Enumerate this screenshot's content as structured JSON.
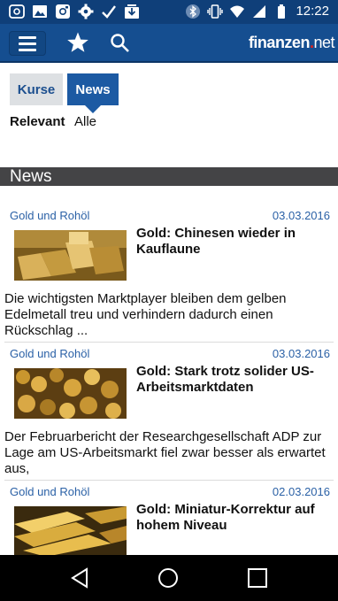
{
  "status_bar": {
    "time": "12:22",
    "left_icons": [
      "app-notification-icon",
      "gallery-icon",
      "instagram-icon",
      "settings-icon",
      "check-icon",
      "download-icon"
    ],
    "right_icons": [
      "bluetooth-icon",
      "vibrate-icon",
      "wifi-icon",
      "signal-icon",
      "battery-icon"
    ]
  },
  "app_bar": {
    "logo_main": "finanzen",
    "logo_dot": ".",
    "logo_tld": "net",
    "icons": [
      "menu-icon",
      "star-icon",
      "search-icon"
    ]
  },
  "tabs": [
    {
      "label": "Kurse",
      "active": false
    },
    {
      "label": "News",
      "active": true
    }
  ],
  "filters": {
    "relevant": "Relevant",
    "alle": "Alle"
  },
  "section": {
    "title": "News"
  },
  "news": [
    {
      "category": "Gold und Rohöl",
      "date": "03.03.2016",
      "headline": "Gold: Chinesen wieder in Kauflaune",
      "teaser": "Die wichtigsten Marktplayer bleiben dem gelben Edelmetall treu und verhindern dadurch einen Rückschlag ..."
    },
    {
      "category": "Gold und Rohöl",
      "date": "03.03.2016",
      "headline": "Gold: Stark trotz solider US-Arbeitsmarktdaten",
      "teaser": "Der Februarbericht der Researchgesellschaft ADP zur Lage am US-Arbeitsmarkt fiel zwar besser als erwartet aus,"
    },
    {
      "category": "Gold und Rohöl",
      "date": "02.03.2016",
      "headline": "Gold: Miniatur-Korrektur auf hohem Niveau",
      "teaser": ""
    }
  ],
  "nav_bar": {
    "icons": [
      "back-icon",
      "home-icon",
      "recents-icon"
    ]
  },
  "colors": {
    "status_bar": "#0f3f79",
    "app_bar": "#154e90",
    "active_tab": "#1c5aa3",
    "link": "#2b61a6",
    "section_header": "#444446",
    "logo_dot": "#e0211b"
  }
}
